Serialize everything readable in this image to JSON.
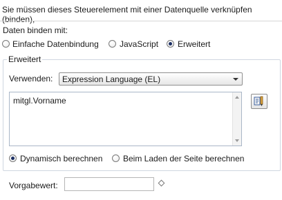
{
  "intro_text": "Sie müssen dieses Steuerelement mit einer Datenquelle verknüpfen (binden),",
  "bind_label": "Daten binden mit:",
  "bind_options": [
    {
      "label": "Einfache Datenbindung",
      "selected": false
    },
    {
      "label": "JavaScript",
      "selected": false
    },
    {
      "label": "Erweitert",
      "selected": true
    }
  ],
  "group_title": "Erweitert",
  "use_label": "Verwenden:",
  "use_select_value": "Expression Language (EL)",
  "expression_text": "mitgl.Vorname",
  "compute_options": [
    {
      "label": "Dynamisch berechnen",
      "selected": true
    },
    {
      "label": "Beim Laden der Seite berechnen",
      "selected": false
    }
  ],
  "default_label": "Vorgabewert:",
  "default_value": "",
  "icons": {
    "edit": "edit-script-icon",
    "select_caret": "chevron-down-icon",
    "diamond": "diamond-icon"
  }
}
